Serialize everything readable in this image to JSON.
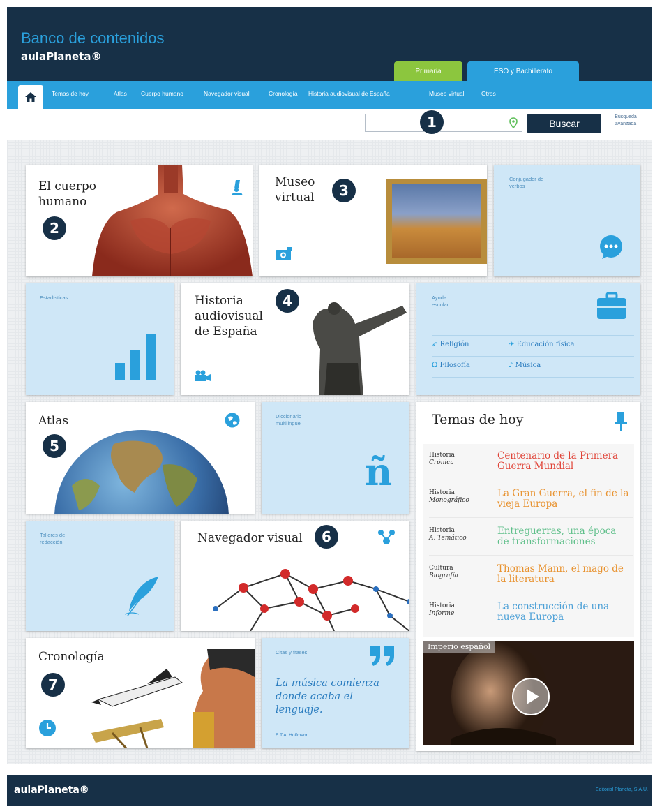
{
  "header": {
    "title": "Banco de contenidos",
    "brand": "aulaPlaneta®",
    "tabs": [
      "Primaria",
      "ESO y Bachillerato"
    ]
  },
  "nav": {
    "items": [
      "Temas de hoy",
      "Atlas",
      "Cuerpo humano",
      "Navegador visual",
      "Cronología",
      "Historia audiovisual de España",
      "Museo virtual",
      "Otros"
    ]
  },
  "search": {
    "placeholder": "",
    "button": "Buscar",
    "advanced": "Búsqueda avanzada"
  },
  "cards": {
    "cuerpo": {
      "title": "El cuerpo humano",
      "num": "2"
    },
    "museo": {
      "title": "Museo virtual",
      "num": "3"
    },
    "conjugador": {
      "label": "Conjugador de verbos"
    },
    "estadisticas": {
      "label": "Estadísticas"
    },
    "historia": {
      "title": "Historia audiovisual de España",
      "num": "4"
    },
    "ayuda": {
      "label": "Ayuda escolar",
      "links": [
        "Religión",
        "Educación física",
        "Filosofía",
        "Música"
      ]
    },
    "atlas": {
      "title": "Atlas",
      "num": "5"
    },
    "diccionario": {
      "label": "Diccionario multilingüe",
      "glyph": "ñ"
    },
    "talleres": {
      "label": "Talleres de redacción"
    },
    "navegador": {
      "title": "Navegador visual",
      "num": "6"
    },
    "cronologia": {
      "title": "Cronología",
      "num": "7"
    },
    "citas": {
      "label": "Citas y frases",
      "quote": "La música comienza donde acaba el lenguaje.",
      "author": "E.T.A. Hoffmann"
    }
  },
  "search_marker": "1",
  "temas": {
    "title": "Temas de hoy",
    "rows": [
      {
        "cat": "Historia",
        "sub": "Crónica",
        "title": "Centenario de la Primera Guerra Mundial",
        "color": "#e04438"
      },
      {
        "cat": "Historia",
        "sub": "Monográfico",
        "title": "La Gran Guerra, el fin de la vieja Europa",
        "color": "#e8922f"
      },
      {
        "cat": "Historia",
        "sub": "A. Temático",
        "title": "Entreguerras, una época de transformaciones",
        "color": "#5fbf8a"
      },
      {
        "cat": "Cultura",
        "sub": "Biografía",
        "title": "Thomas Mann, el mago de la literatura",
        "color": "#e8922f"
      },
      {
        "cat": "Historia",
        "sub": "Informe",
        "title": "La construcción de una nueva Europa",
        "color": "#4a9fd6"
      }
    ],
    "video_label": "Imperio español"
  },
  "footer": {
    "brand": "aulaPlaneta®",
    "copyright": "Editorial Planeta, S.A.U."
  },
  "colors": {
    "navy": "#173047",
    "blue": "#2aa0dc",
    "green": "#8cc63e",
    "card_blue": "#cfe7f7"
  }
}
